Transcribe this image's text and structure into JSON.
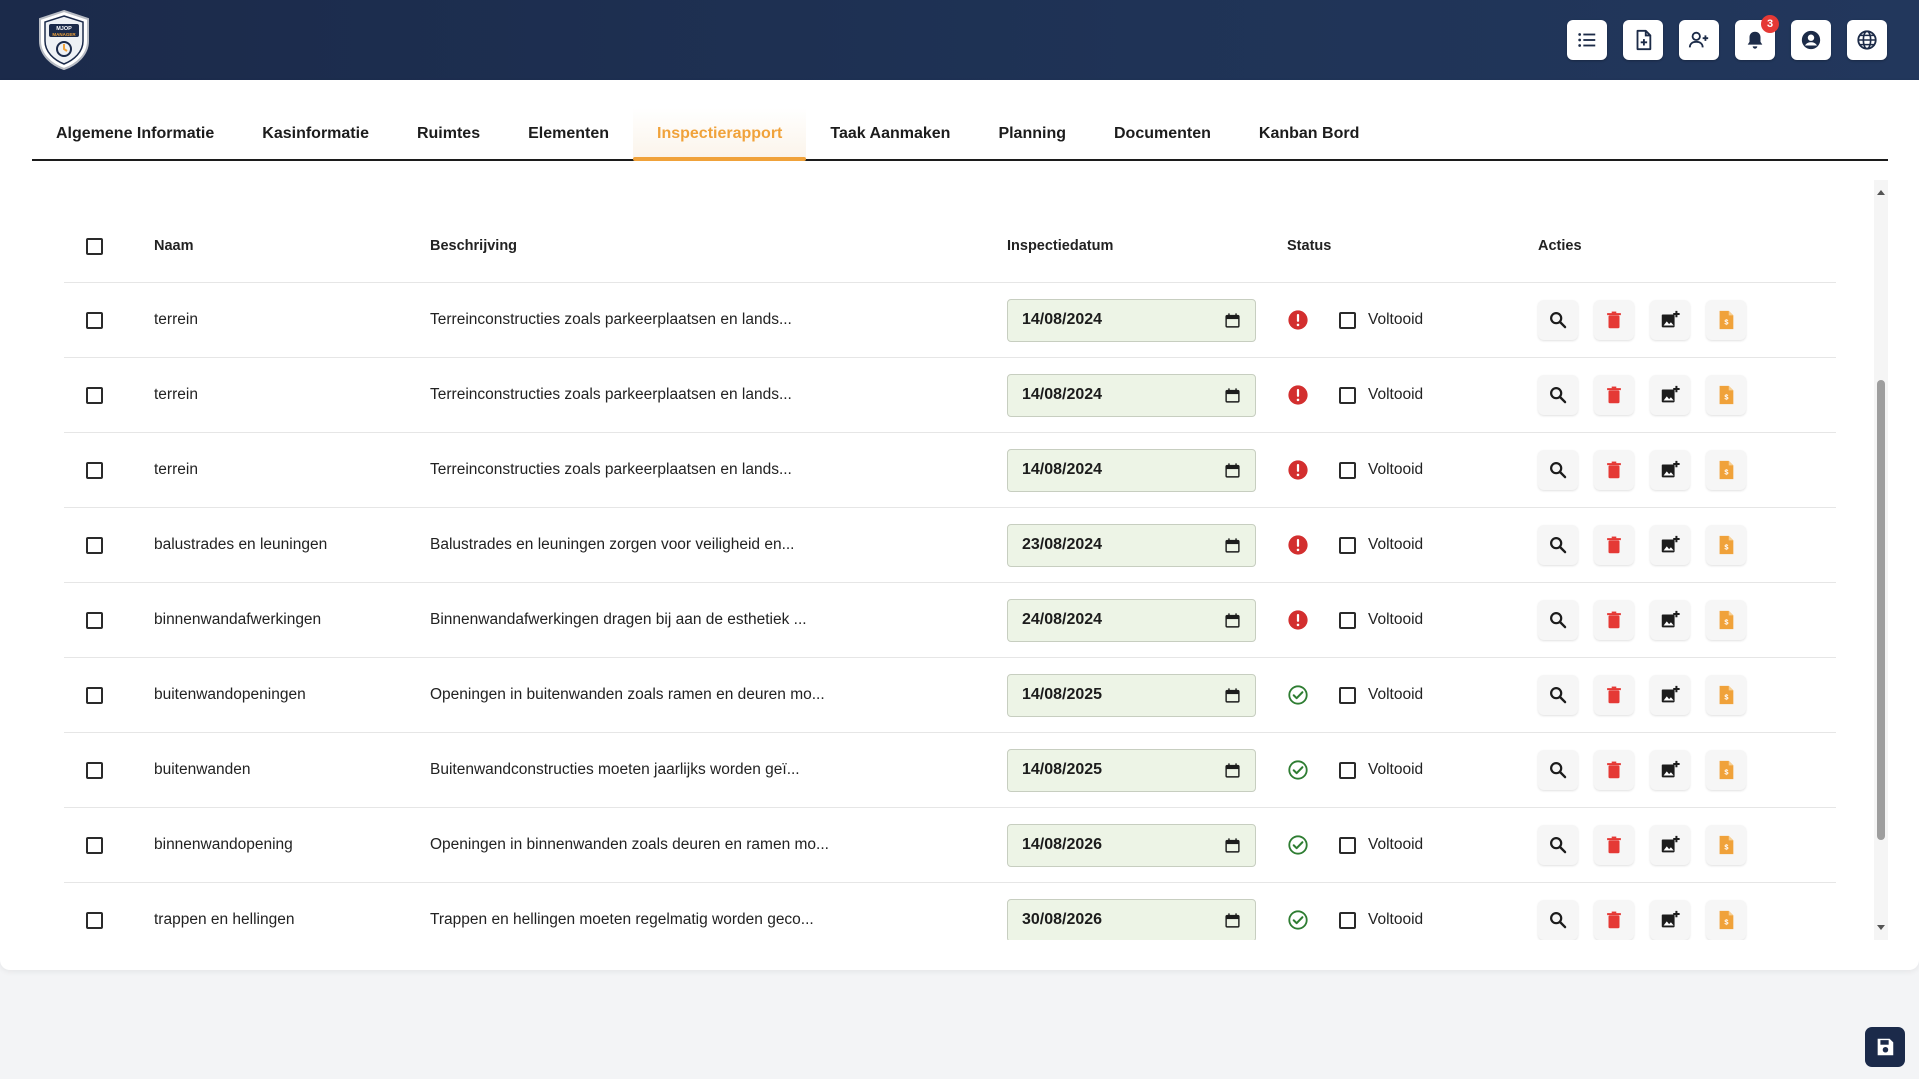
{
  "header": {
    "logo_text": "MJOP MANAGER",
    "notification_count": "3",
    "icons": [
      "list-icon",
      "add-document-icon",
      "add-user-icon",
      "bell-icon",
      "account-icon",
      "globe-icon"
    ]
  },
  "tabs": [
    {
      "label": "Algemene Informatie",
      "active": false
    },
    {
      "label": "Kasinformatie",
      "active": false
    },
    {
      "label": "Ruimtes",
      "active": false
    },
    {
      "label": "Elementen",
      "active": false
    },
    {
      "label": "Inspectierapport",
      "active": true
    },
    {
      "label": "Taak Aanmaken",
      "active": false
    },
    {
      "label": "Planning",
      "active": false
    },
    {
      "label": "Documenten",
      "active": false
    },
    {
      "label": "Kanban Bord",
      "active": false
    }
  ],
  "table": {
    "headers": {
      "name": "Naam",
      "description": "Beschrijving",
      "date": "Inspectiedatum",
      "status": "Status",
      "actions": "Acties"
    },
    "completed_label": "Voltooid",
    "rows": [
      {
        "name": "terrein",
        "description": "Terreinconstructies zoals parkeerplaatsen en lands...",
        "date": "14/08/2024",
        "status": "overdue"
      },
      {
        "name": "terrein",
        "description": "Terreinconstructies zoals parkeerplaatsen en lands...",
        "date": "14/08/2024",
        "status": "overdue"
      },
      {
        "name": "terrein",
        "description": "Terreinconstructies zoals parkeerplaatsen en lands...",
        "date": "14/08/2024",
        "status": "overdue"
      },
      {
        "name": "balustrades en leuningen",
        "description": "Balustrades en leuningen zorgen voor veiligheid en...",
        "date": "23/08/2024",
        "status": "overdue"
      },
      {
        "name": "binnenwandafwerkingen",
        "description": "Binnenwandafwerkingen dragen bij aan de esthetiek ...",
        "date": "24/08/2024",
        "status": "overdue"
      },
      {
        "name": "buitenwandopeningen",
        "description": "Openingen in buitenwanden zoals ramen en deuren mo...",
        "date": "14/08/2025",
        "status": "ok"
      },
      {
        "name": "buitenwanden",
        "description": "Buitenwandconstructies moeten jaarlijks worden geï...",
        "date": "14/08/2025",
        "status": "ok"
      },
      {
        "name": "binnenwandopening",
        "description": "Openingen in binnenwanden zoals deuren en ramen mo...",
        "date": "14/08/2026",
        "status": "ok"
      },
      {
        "name": "trappen en hellingen",
        "description": "Trappen en hellingen moeten regelmatig worden geco...",
        "date": "30/08/2026",
        "status": "ok"
      }
    ]
  },
  "colors": {
    "header_bg": "#1b2a4a",
    "accent": "#f0a23a",
    "overdue": "#d32f2f",
    "ok": "#2e7d32",
    "delete": "#e53935",
    "pdf": "#f0a23a"
  }
}
